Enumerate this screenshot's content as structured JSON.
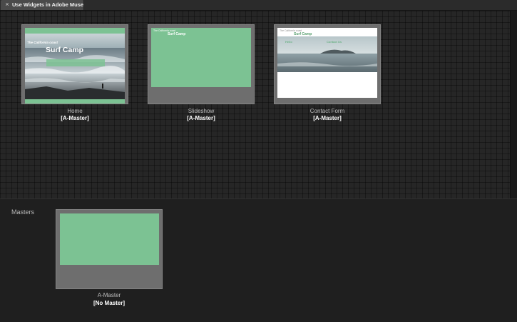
{
  "tab": {
    "title": "Use Widgets in Adobe Muse",
    "close_glyph": "×"
  },
  "pages": [
    {
      "name": "Home",
      "master": "[A-Master]",
      "thumb_tagline": "The California coast",
      "thumb_title": "Surf Camp"
    },
    {
      "name": "Slideshow",
      "master": "[A-Master]",
      "thumb_tagline": "The California coast",
      "thumb_title": "Surf Camp"
    },
    {
      "name": "Contact Form",
      "master": "[A-Master]",
      "thumb_tagline": "The California coast",
      "thumb_title": "Surf Camp",
      "thumb_heading_left": "Hello",
      "thumb_heading_right": "Contact Us"
    }
  ],
  "masters_section": {
    "title": "Masters",
    "items": [
      {
        "name": "A-Master",
        "master": "[No Master]"
      }
    ]
  },
  "colors": {
    "page_green": "#7cc293",
    "thumb_frame": "#6e6e6e",
    "background": "#1f1f1f"
  }
}
